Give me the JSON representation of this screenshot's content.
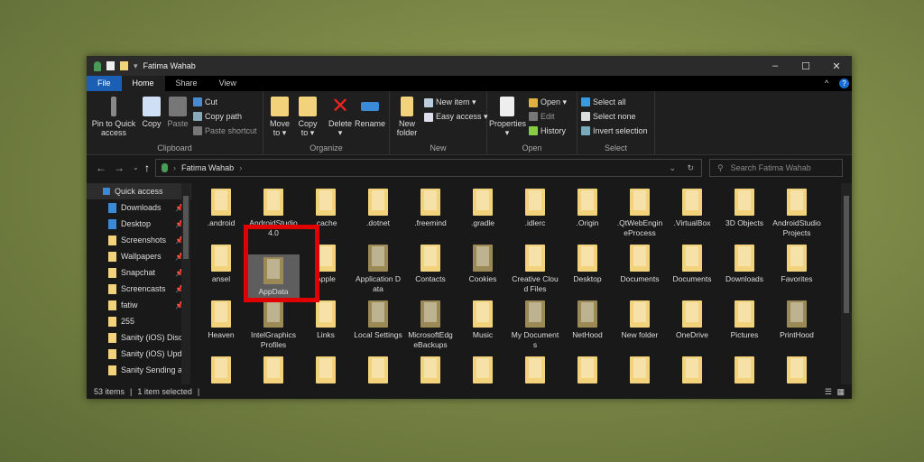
{
  "window": {
    "title": "Fatima Wahab",
    "minimize": "–",
    "maximize": "☐",
    "close": "✕",
    "help": "?",
    "collapse": "^"
  },
  "tabs": [
    "File",
    "Home",
    "Share",
    "View"
  ],
  "ribbon": {
    "clipboard": {
      "label": "Clipboard",
      "pin": "Pin to Quick access",
      "copy": "Copy",
      "paste": "Paste",
      "cut": "Cut",
      "copy_path": "Copy path",
      "paste_shortcut": "Paste shortcut"
    },
    "organize": {
      "label": "Organize",
      "move_to": "Move to ▾",
      "copy_to": "Copy to ▾",
      "delete": "Delete ▾",
      "rename": "Rename"
    },
    "new": {
      "label": "New",
      "new_folder": "New folder",
      "new_item": "New item ▾",
      "easy_access": "Easy access ▾"
    },
    "open": {
      "label": "Open",
      "properties": "Properties ▾",
      "open": "Open ▾",
      "edit": "Edit",
      "history": "History"
    },
    "select": {
      "label": "Select",
      "select_all": "Select all",
      "select_none": "Select none",
      "invert": "Invert selection"
    }
  },
  "address": {
    "path": "Fatima Wahab",
    "search_placeholder": "Search Fatima Wahab"
  },
  "sidebar": [
    {
      "label": "Quick access",
      "pinned": false
    },
    {
      "label": "Downloads",
      "pinned": true
    },
    {
      "label": "Desktop",
      "pinned": true
    },
    {
      "label": "Screenshots",
      "pinned": true
    },
    {
      "label": "Wallpapers",
      "pinned": true
    },
    {
      "label": "Snapchat",
      "pinned": true
    },
    {
      "label": "Screencasts",
      "pinned": true
    },
    {
      "label": "fatiw",
      "pinned": true
    },
    {
      "label": "255",
      "pinned": false
    },
    {
      "label": "Sanity (iOS) Disc",
      "pinned": false
    },
    {
      "label": "Sanity (iOS) Upd",
      "pinned": false
    },
    {
      "label": "Sanity Sending a",
      "pinned": false
    }
  ],
  "items": [
    ".android",
    "AndroidStudio4.0",
    ".cache",
    ".dotnet",
    ".freemind",
    ".gradle",
    ".idlerc",
    ".Origin",
    ".QtWebEngineProcess",
    ".VirtualBox",
    "3D Objects",
    "AndroidStudioProjects",
    "ansel",
    "AppData",
    "Apple",
    "Application Data",
    "Contacts",
    "Cookies",
    "Creative Cloud Files",
    "Desktop",
    "Documents",
    "Documents",
    "Downloads",
    "Favorites",
    "Heaven",
    "IntelGraphicsProfiles",
    "Links",
    "Local Settings",
    "MicrosoftEdgeBackups",
    "Music",
    "My Documents",
    "NetHood",
    "New folder",
    "OneDrive",
    "Pictures",
    "PrintHood",
    "",
    "",
    "",
    "",
    "",
    "",
    "",
    "",
    "",
    "",
    "",
    ""
  ],
  "selected_item": "AppData",
  "status": {
    "count": "53 items",
    "selected": "1 item selected"
  }
}
